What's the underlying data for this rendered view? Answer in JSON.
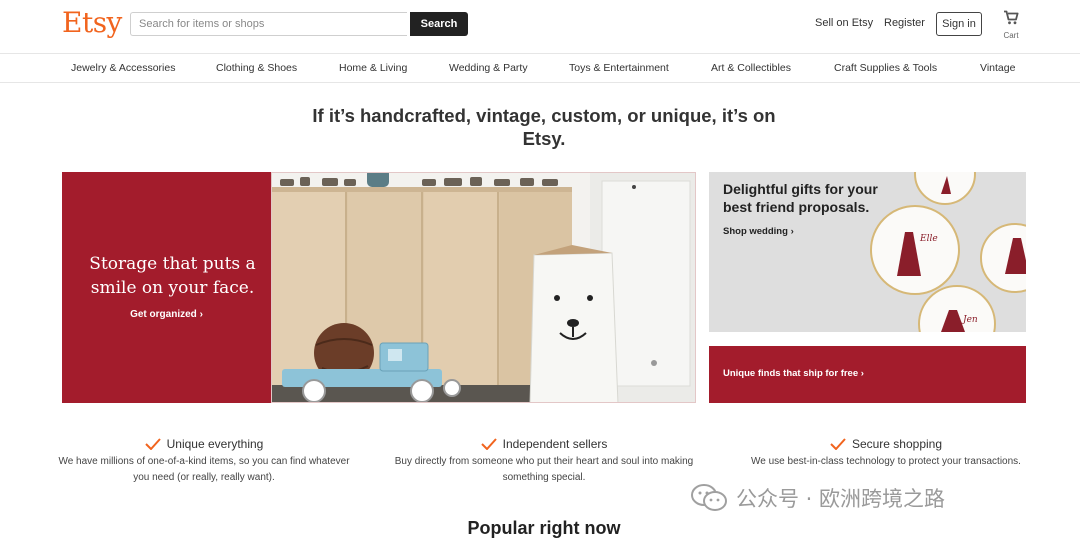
{
  "brand": {
    "logo_text": "Etsy",
    "accent_color": "#F1641E",
    "hero_color": "#A31C2C"
  },
  "search": {
    "placeholder": "Search for items or shops",
    "value": "",
    "button_label": "Search"
  },
  "header_links": {
    "sell": "Sell on Etsy",
    "register": "Register",
    "signin": "Sign in",
    "cart_label": "Cart",
    "cart_icon": "cart-icon"
  },
  "categories": [
    "Jewelry & Accessories",
    "Clothing & Shoes",
    "Home & Living",
    "Wedding & Party",
    "Toys & Entertainment",
    "Art & Collectibles",
    "Craft Supplies & Tools",
    "Vintage"
  ],
  "headline": "If it’s handcrafted, vintage, custom, or unique, it’s on Etsy.",
  "hero": {
    "title": "Storage that puts a smile on your face.",
    "link": "Get organized"
  },
  "side_top": {
    "title": "Delightful gifts for your best friend proposals.",
    "link": "Shop wedding",
    "plate_text_1": "Elle",
    "plate_text_2": "Jen"
  },
  "side_bottom": {
    "label": "Unique finds that ship for free"
  },
  "values": [
    {
      "title": "Unique everything",
      "desc": "We have millions of one-of-a-kind items, so you can find whatever you need (or really, really want)."
    },
    {
      "title": "Independent sellers",
      "desc": "Buy directly from someone who put their heart and soul into making something special."
    },
    {
      "title": "Secure shopping",
      "desc": "We use best-in-class technology to protect your transactions."
    }
  ],
  "popular_heading": "Popular right now",
  "watermark": {
    "text": "公众号 · 欧洲跨境之路"
  }
}
